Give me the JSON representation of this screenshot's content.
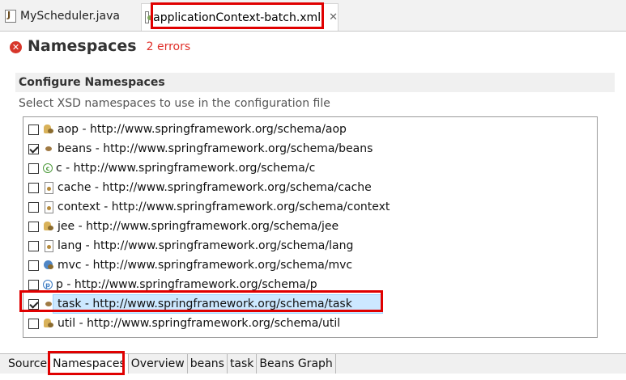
{
  "editor_tabs": [
    {
      "label": "MyScheduler.java",
      "icon": "java-file-icon",
      "active": false
    },
    {
      "label": "applicationContext-batch.xml",
      "icon": "xml-file-icon",
      "active": true,
      "close": "✕"
    }
  ],
  "header": {
    "title": "Namespaces",
    "errors": "2 errors",
    "icon": "error-icon"
  },
  "section": {
    "title": "Configure Namespaces",
    "description": "Select XSD namespaces to use in the configuration file"
  },
  "namespaces": [
    {
      "label": "aop - http://www.springframework.org/schema/aop",
      "checked": false,
      "icon": "aop-namespace-icon"
    },
    {
      "label": "beans - http://www.springframework.org/schema/beans",
      "checked": true,
      "icon": "beans-namespace-icon"
    },
    {
      "label": "c - http://www.springframework.org/schema/c",
      "checked": false,
      "icon": "c-namespace-icon"
    },
    {
      "label": "cache - http://www.springframework.org/schema/cache",
      "checked": false,
      "icon": "cache-namespace-icon"
    },
    {
      "label": "context - http://www.springframework.org/schema/context",
      "checked": false,
      "icon": "context-namespace-icon"
    },
    {
      "label": "jee - http://www.springframework.org/schema/jee",
      "checked": false,
      "icon": "jee-namespace-icon"
    },
    {
      "label": "lang - http://www.springframework.org/schema/lang",
      "checked": false,
      "icon": "lang-namespace-icon"
    },
    {
      "label": "mvc - http://www.springframework.org/schema/mvc",
      "checked": false,
      "icon": "mvc-namespace-icon"
    },
    {
      "label": "p - http://www.springframework.org/schema/p",
      "checked": false,
      "icon": "p-namespace-icon"
    },
    {
      "label": "task - http://www.springframework.org/schema/task",
      "checked": true,
      "icon": "task-namespace-icon",
      "selected": true
    },
    {
      "label": "util - http://www.springframework.org/schema/util",
      "checked": false,
      "icon": "util-namespace-icon"
    }
  ],
  "bottom_tabs": [
    {
      "label": "Source",
      "active": false
    },
    {
      "label": "Namespaces",
      "active": true
    },
    {
      "label": "Overview",
      "active": false
    },
    {
      "label": "beans",
      "active": false
    },
    {
      "label": "task",
      "active": false
    },
    {
      "label": "Beans Graph",
      "active": false
    }
  ],
  "colors": {
    "highlight_box": "#e00000",
    "selection": "#cce8ff",
    "error_text": "#e0302a"
  }
}
